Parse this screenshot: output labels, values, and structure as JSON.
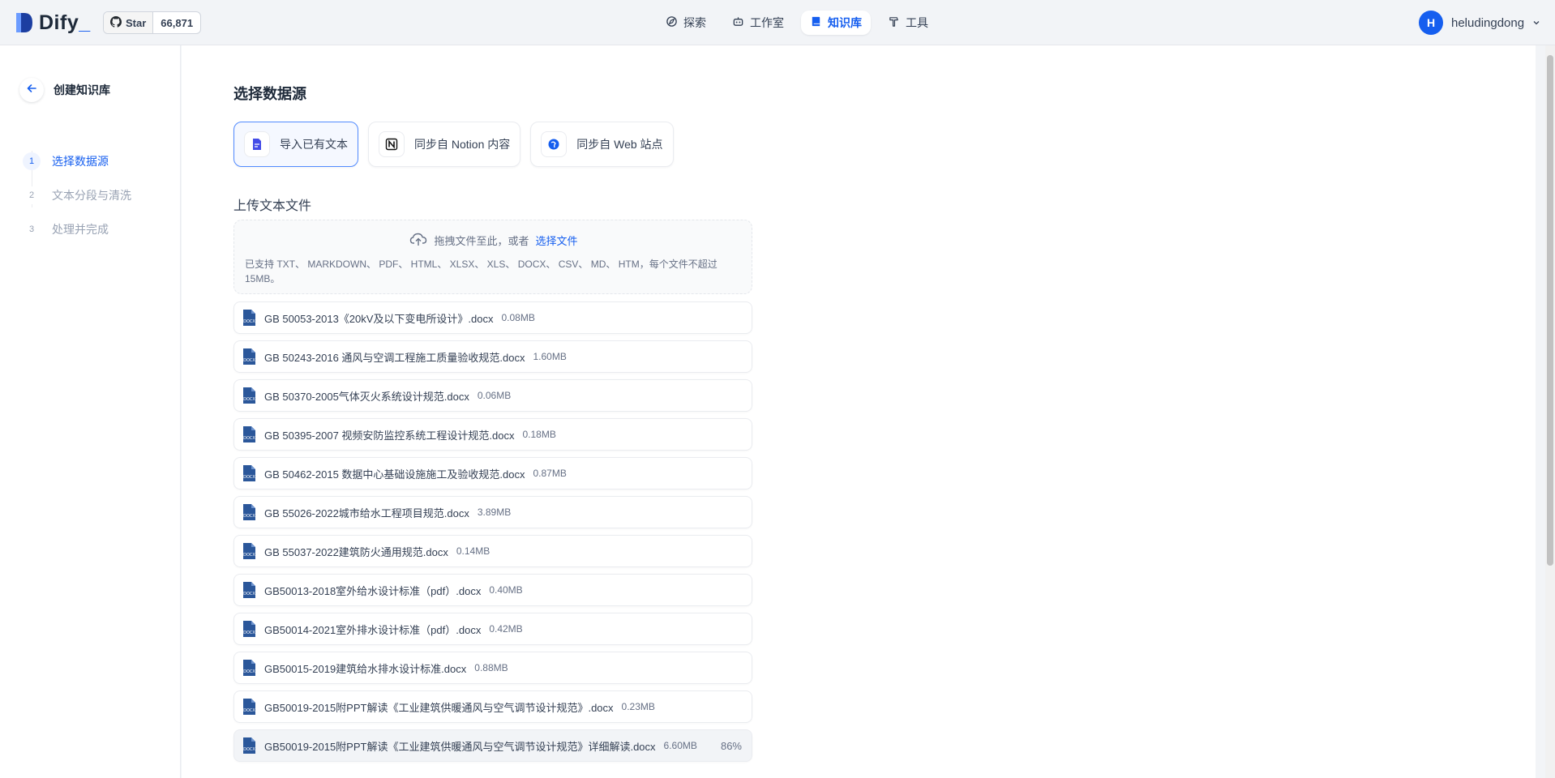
{
  "app": {
    "logo_text": "Dify",
    "logo_suffix": "_"
  },
  "github": {
    "star_label": "Star",
    "star_count": "66,871"
  },
  "nav": [
    {
      "label": "探索",
      "icon": "explore-icon",
      "active": false
    },
    {
      "label": "工作室",
      "icon": "robot-icon",
      "active": false
    },
    {
      "label": "知识库",
      "icon": "book-icon",
      "active": true
    },
    {
      "label": "工具",
      "icon": "hammer-icon",
      "active": false
    }
  ],
  "user": {
    "initial": "H",
    "name": "heludingdong"
  },
  "sidebar": {
    "title": "创建知识库",
    "steps": [
      {
        "num": "1",
        "label": "选择数据源",
        "active": true
      },
      {
        "num": "2",
        "label": "文本分段与清洗",
        "active": false
      },
      {
        "num": "3",
        "label": "处理并完成",
        "active": false
      }
    ]
  },
  "main": {
    "title": "选择数据源",
    "sources": [
      {
        "label": "导入已有文本",
        "icon": "document-icon",
        "active": true
      },
      {
        "label": "同步自 Notion 内容",
        "icon": "notion-icon",
        "active": false
      },
      {
        "label": "同步自 Web 站点",
        "icon": "web-icon",
        "active": false
      }
    ],
    "upload_title": "上传文本文件",
    "dropzone": {
      "text": "拖拽文件至此，或者",
      "link": "选择文件",
      "hint": "已支持 TXT、 MARKDOWN、 PDF、 HTML、 XLSX、 XLS、 DOCX、 CSV、 MD、 HTM，每个文件不超过 15MB。"
    },
    "files": [
      {
        "name": "GB 50053-2013《20kV及以下变电所设计》.docx",
        "size": "0.08MB"
      },
      {
        "name": "GB 50243-2016 通风与空调工程施工质量验收规范.docx",
        "size": "1.60MB"
      },
      {
        "name": "GB 50370-2005气体灭火系统设计规范.docx",
        "size": "0.06MB"
      },
      {
        "name": "GB 50395-2007 视频安防监控系统工程设计规范.docx",
        "size": "0.18MB"
      },
      {
        "name": "GB 50462-2015 数据中心基础设施施工及验收规范.docx",
        "size": "0.87MB"
      },
      {
        "name": "GB 55026-2022城市给水工程项目规范.docx",
        "size": "3.89MB"
      },
      {
        "name": "GB 55037-2022建筑防火通用规范.docx",
        "size": "0.14MB"
      },
      {
        "name": "GB50013-2018室外给水设计标准（pdf）.docx",
        "size": "0.40MB"
      },
      {
        "name": "GB50014-2021室外排水设计标准（pdf）.docx",
        "size": "0.42MB"
      },
      {
        "name": "GB50015-2019建筑给水排水设计标准.docx",
        "size": "0.88MB"
      },
      {
        "name": "GB50019-2015附PPT解读《工业建筑供暖通风与空气调节设计规范》.docx",
        "size": "0.23MB"
      },
      {
        "name": "GB50019-2015附PPT解读《工业建筑供暖通风与空气调节设计规范》详细解读.docx",
        "size": "6.60MB",
        "progress": "86%"
      }
    ]
  },
  "colors": {
    "accent": "#155eef",
    "text": "#1d2939",
    "muted": "#667085"
  }
}
